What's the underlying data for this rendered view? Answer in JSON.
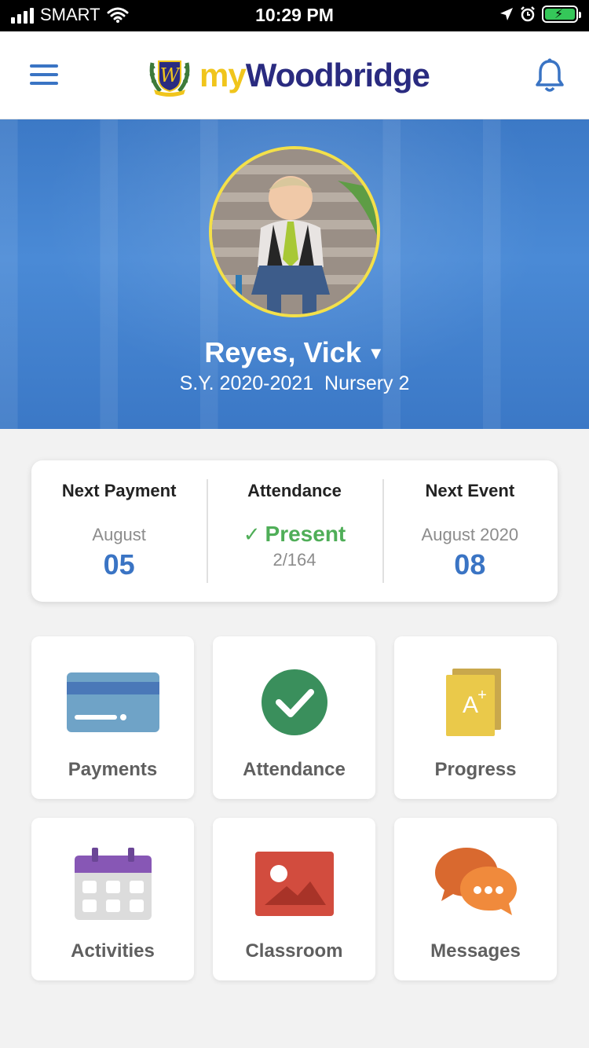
{
  "status_bar": {
    "carrier": "SMART",
    "time": "10:29 PM"
  },
  "header": {
    "brand_my": "my",
    "brand_name": "Woodbridge",
    "menu_icon": "hamburger-icon",
    "notification_icon": "bell-icon"
  },
  "profile": {
    "name": "Reyes, Vick",
    "school_year": "S.Y. 2020-2021",
    "grade": "Nursery 2"
  },
  "summary": {
    "next_payment": {
      "title": "Next Payment",
      "month": "August",
      "day": "05"
    },
    "attendance": {
      "title": "Attendance",
      "status": "Present",
      "count": "2/164"
    },
    "next_event": {
      "title": "Next Event",
      "month": "August 2020",
      "day": "08"
    }
  },
  "tiles": [
    {
      "label": "Payments",
      "icon": "credit-card-icon"
    },
    {
      "label": "Attendance",
      "icon": "check-circle-icon"
    },
    {
      "label": "Progress",
      "icon": "grade-card-icon"
    },
    {
      "label": "Activities",
      "icon": "calendar-icon"
    },
    {
      "label": "Classroom",
      "icon": "image-icon"
    },
    {
      "label": "Messages",
      "icon": "chat-bubbles-icon"
    }
  ],
  "colors": {
    "accent_blue": "#3a74c4",
    "brand_yellow": "#f0c51c",
    "brand_navy": "#2a2b80",
    "present_green": "#4fae58"
  }
}
